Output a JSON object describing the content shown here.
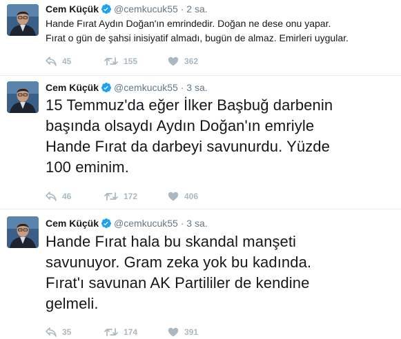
{
  "colors": {
    "verified": "#1da1f2",
    "action_gray": "#aab8c2",
    "meta_gray": "#657786",
    "divider": "#e6ecf0"
  },
  "tweets": [
    {
      "author": {
        "name": "Cem Küçük",
        "handle": "@cemkucuk55",
        "verified": true
      },
      "dot": "·",
      "time": "2 sa.",
      "text": "Hande Fırat Aydın Doğan'ın emrindedir. Doğan ne dese onu yapar.\nFırat o gün de şahsi inisiyatif almadı, bugün de almaz. Emirleri uygular.",
      "counts": {
        "replies": "45",
        "retweets": "155",
        "likes": "362"
      }
    },
    {
      "author": {
        "name": "Cem Küçük",
        "handle": "@cemkucuk55",
        "verified": true
      },
      "dot": "·",
      "time": "3 sa.",
      "text": "15 Temmuz'da eğer İlker Başbuğ darbenin\nbaşında olsaydı Aydın Doğan'ın emriyle\nHande Fırat da darbeyi savunurdu. Yüzde\n100 eminim.",
      "counts": {
        "replies": "46",
        "retweets": "172",
        "likes": "406"
      }
    },
    {
      "author": {
        "name": "Cem Küçük",
        "handle": "@cemkucuk55",
        "verified": true
      },
      "dot": "·",
      "time": "3 sa.",
      "text": "Hande Fırat hala bu skandal manşeti\nsavunuyor. Gram zeka yok bu kadında.\nFırat'ı savunan AK Partililer de kendine\ngelmeli.",
      "counts": {
        "replies": "35",
        "retweets": "174",
        "likes": "391"
      }
    }
  ]
}
